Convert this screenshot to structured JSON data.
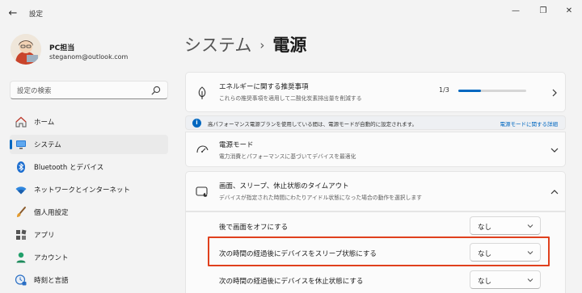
{
  "window": {
    "title": "設定",
    "back_glyph": "←",
    "minimize_glyph": "—",
    "maximize_glyph": "❐",
    "close_glyph": "✕"
  },
  "profile": {
    "name": "PC担当",
    "email": "steganom@outlook.com"
  },
  "search": {
    "placeholder": "設定の検索",
    "icon": "search-icon"
  },
  "sidebar": {
    "items": [
      {
        "label": "ホーム",
        "icon": "home-icon",
        "active": false
      },
      {
        "label": "システム",
        "icon": "system-monitor-icon",
        "active": true
      },
      {
        "label": "Bluetooth とデバイス",
        "icon": "bluetooth-icon",
        "active": false
      },
      {
        "label": "ネットワークとインターネット",
        "icon": "wifi-icon",
        "active": false
      },
      {
        "label": "個人用設定",
        "icon": "brush-icon",
        "active": false
      },
      {
        "label": "アプリ",
        "icon": "apps-icon",
        "active": false
      },
      {
        "label": "アカウント",
        "icon": "account-icon",
        "active": false
      },
      {
        "label": "時刻と言語",
        "icon": "clock-language-icon",
        "active": false
      }
    ]
  },
  "breadcrumb": {
    "parent": "システム",
    "separator": "›",
    "current": "電源"
  },
  "energy_card": {
    "title": "エネルギーに関する推奨事項",
    "description": "これらの推奨事項を適用して二酸化炭素排出量を削減する",
    "progress_text": "1/3",
    "progress_fraction": 0.33
  },
  "info_banner": {
    "text": "高パフォーマンス電源プランを使用している間は、電源モードが自動的に設定されます。",
    "link": "電源モードに関する詳細"
  },
  "power_mode_card": {
    "title": "電源モード",
    "description": "電力消費とパフォーマンスに基づいてデバイスを最適化"
  },
  "timeout_card": {
    "title": "画面、スリープ、休止状態のタイムアウト",
    "description": "デバイスが指定された時間にわたりアイドル状態になった場合の動作を選択します",
    "rows": [
      {
        "label": "後で画面をオフにする",
        "value": "なし"
      },
      {
        "label": "次の時間の経過後にデバイスをスリープ状態にする",
        "value": "なし"
      },
      {
        "label": "次の時間の経過後にデバイスを休止状態にする",
        "value": "なし"
      }
    ]
  },
  "colors": {
    "accent": "#0067c0",
    "highlight": "#e0401d",
    "background": "#f3f3f3"
  }
}
